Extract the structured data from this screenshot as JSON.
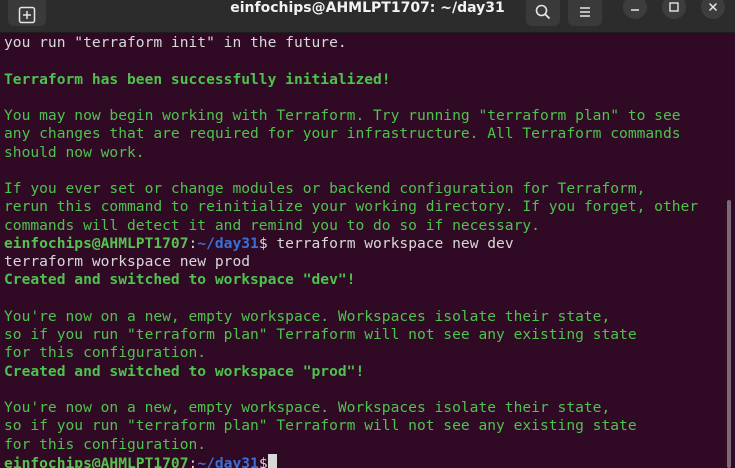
{
  "window": {
    "title": "einfochips@AHMLPT1707: ~/day31"
  },
  "icons": {
    "new_tab": "new-tab-icon",
    "search": "search-icon",
    "menu": "hamburger-menu-icon",
    "minimize": "minimize-icon",
    "maximize": "maximize-icon",
    "close": "close-icon"
  },
  "colors": {
    "background": "#300a24",
    "text": "#d8d8d8",
    "success": "#4ec24e",
    "prompt_user": "#56c24e",
    "prompt_path": "#3a6fd8"
  },
  "terminal": {
    "line1": "you run \"terraform init\" in the future.",
    "line2": "",
    "line3": "Terraform has been successfully initialized!",
    "line4": "",
    "line5": "You may now begin working with Terraform. Try running \"terraform plan\" to see",
    "line6": "any changes that are required for your infrastructure. All Terraform commands",
    "line7": "should now work.",
    "line8": "",
    "line9": "If you ever set or change modules or backend configuration for Terraform,",
    "line10": "rerun this command to reinitialize your working directory. If you forget, other",
    "line11": "commands will detect it and remind you to do so if necessary.",
    "prompt1_user": "einfochips@AHMLPT1707",
    "prompt1_colon": ":",
    "prompt1_path": "~/day31",
    "prompt1_cmd": "$ terraform workspace new dev",
    "line13": "terraform workspace new prod",
    "line14": "Created and switched to workspace \"dev\"!",
    "line15": "",
    "line16": "You're now on a new, empty workspace. Workspaces isolate their state,",
    "line17": "so if you run \"terraform plan\" Terraform will not see any existing state",
    "line18": "for this configuration.",
    "line19": "Created and switched to workspace \"prod\"!",
    "line20": "",
    "line21": "You're now on a new, empty workspace. Workspaces isolate their state,",
    "line22": "so if you run \"terraform plan\" Terraform will not see any existing state",
    "line23": "for this configuration.",
    "prompt2_user": "einfochips@AHMLPT1707",
    "prompt2_colon": ":",
    "prompt2_path": "~/day31",
    "prompt2_cmd": "$"
  }
}
